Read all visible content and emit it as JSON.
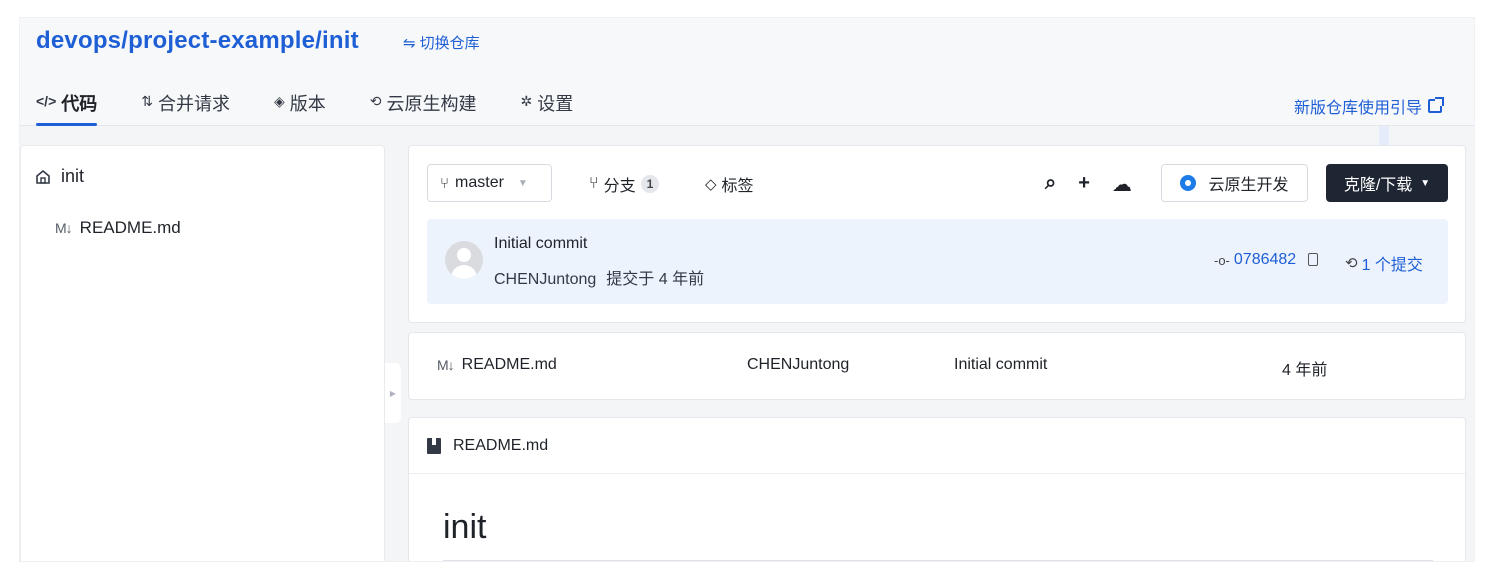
{
  "header": {
    "repo_path": "devops/project-example/init",
    "switch_label": "切换仓库",
    "guide_label": "新版仓库使用引导"
  },
  "tabs": [
    {
      "label": "代码",
      "icon": "code-icon",
      "active": true
    },
    {
      "label": "合并请求",
      "icon": "merge-request-icon",
      "active": false
    },
    {
      "label": "版本",
      "icon": "layers-icon",
      "active": false
    },
    {
      "label": "云原生构建",
      "icon": "build-icon",
      "active": false
    },
    {
      "label": "设置",
      "icon": "gear-icon",
      "active": false
    }
  ],
  "sidebar": {
    "root": "init",
    "files": [
      {
        "name": "README.md",
        "icon": "markdown-icon"
      }
    ]
  },
  "toolbar": {
    "branch": "master",
    "branches_label": "分支",
    "branches_count": "1",
    "tags_label": "标签",
    "cloud_dev_label": "云原生开发",
    "clone_label": "克隆/下载"
  },
  "last_commit": {
    "message": "Initial commit",
    "author": "CHENJuntong",
    "when": "提交于 4 年前",
    "hash": "0786482",
    "commit_count": "1 个提交"
  },
  "file_list": [
    {
      "name": "README.md",
      "author": "CHENJuntong",
      "message": "Initial commit",
      "time": "4 年前"
    }
  ],
  "readme": {
    "file_label": "README.md",
    "heading": "init"
  },
  "colors": {
    "accent": "#1f5fd6",
    "dark_button": "#1f2633",
    "commit_bg": "#edf3fd"
  }
}
